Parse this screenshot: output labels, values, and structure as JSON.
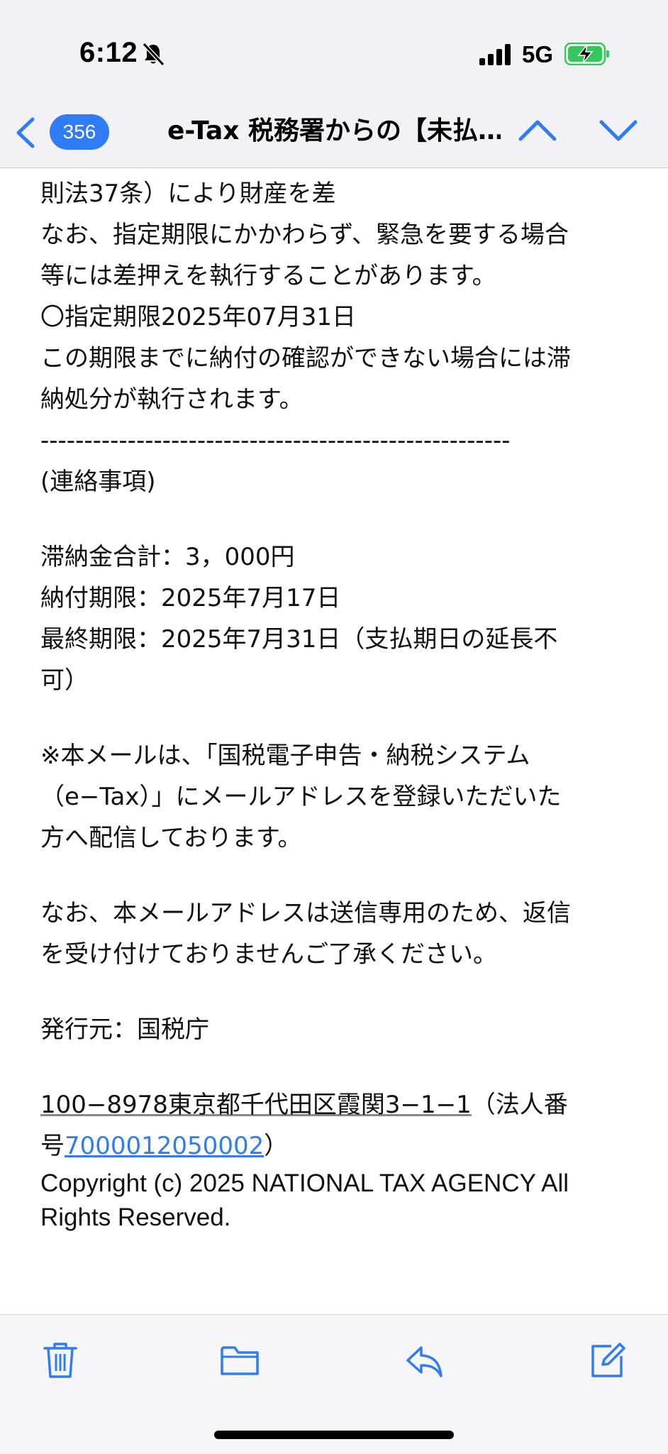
{
  "status_bar": {
    "time": "6:12",
    "network": "5G"
  },
  "nav": {
    "badge_count": "356",
    "title": "e-Tax 税務署からの【未払…"
  },
  "body": {
    "lines": [
      "則法37条）により財産を差",
      "なお、指定期限にかかわらず、緊急を要する場合",
      "等には差押えを執行することがあります。",
      "〇指定期限2025年07月31日",
      "この期限までに納付の確認ができない場合には滞",
      "納処分が執行されます。",
      "------------------------------------------------------",
      "(連絡事項)"
    ],
    "details": [
      "滞納金合計：3，000円",
      "納付期限：2025年7月17日",
      "最終期限：2025年7月31日（支払期日の延長不",
      "可）"
    ],
    "notice": [
      "※本メールは、「国税電子申告・納税システム",
      "（e−Tax）」にメールアドレスを登録いただいた",
      "方へ配信しております。"
    ],
    "no_reply": [
      "なお、本メールアドレスは送信専用のため、返信",
      "を受け付けておりませんご了承ください。"
    ],
    "issuer": "発行元：国税庁",
    "address": "100−8978東京都千代田区霞関3−1−1",
    "corp_label_1": "（法人番",
    "corp_label_2": "号",
    "corp_number": "7000012050002",
    "corp_close": "）",
    "copyright_1": "Copyright (c) 2025 NATIONAL TAX AGENCY All",
    "copyright_2": "Rights Reserved."
  },
  "colors": {
    "accent": "#2f7cf6",
    "bar_bg": "#f2f2f6",
    "battery": "#34c759"
  },
  "icons": [
    "bell-slash-icon",
    "signal-icon",
    "battery-charging-icon",
    "back-chevron-icon",
    "up-chevron-icon",
    "down-chevron-icon",
    "trash-icon",
    "folder-icon",
    "reply-icon",
    "compose-icon"
  ]
}
